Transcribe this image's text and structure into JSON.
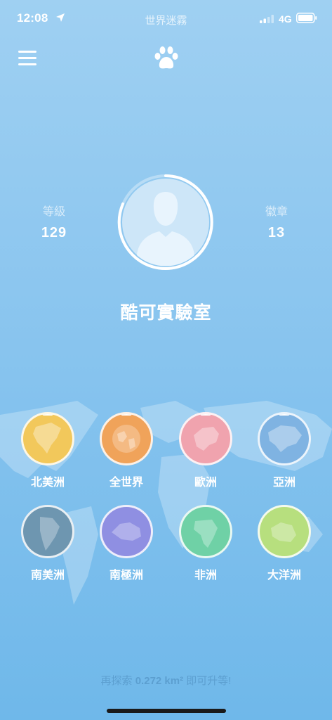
{
  "status_bar": {
    "time": "12:08",
    "app_title": "世界迷霧",
    "network": "4G"
  },
  "nav": {
    "menu_icon": "hamburger-icon",
    "logo_icon": "paw-icon"
  },
  "profile": {
    "level_label": "等級",
    "level_value": "129",
    "badge_label": "徽章",
    "badge_value": "13",
    "username": "酷可實驗室",
    "avatar_icon": "user-silhouette-icon"
  },
  "continents": [
    {
      "label": "北美洲",
      "color": "#f2c85b"
    },
    {
      "label": "全世界",
      "color": "#f0a35a"
    },
    {
      "label": "歐洲",
      "color": "#f0a3ae"
    },
    {
      "label": "亞洲",
      "color": "#7fb3e2"
    },
    {
      "label": "南美洲",
      "color": "#6e96b0"
    },
    {
      "label": "南極洲",
      "color": "#8f8fe2"
    },
    {
      "label": "非洲",
      "color": "#6fd1a6"
    },
    {
      "label": "大洋洲",
      "color": "#b7df7e"
    }
  ],
  "footer": {
    "prefix": "再探索 ",
    "amount": "0.272 km²",
    "suffix": " 即可升等!"
  },
  "colors": {
    "background_top": "#9fd0f2",
    "background_bottom": "#6fb8ea",
    "footer_text": "#5c9fd0"
  }
}
